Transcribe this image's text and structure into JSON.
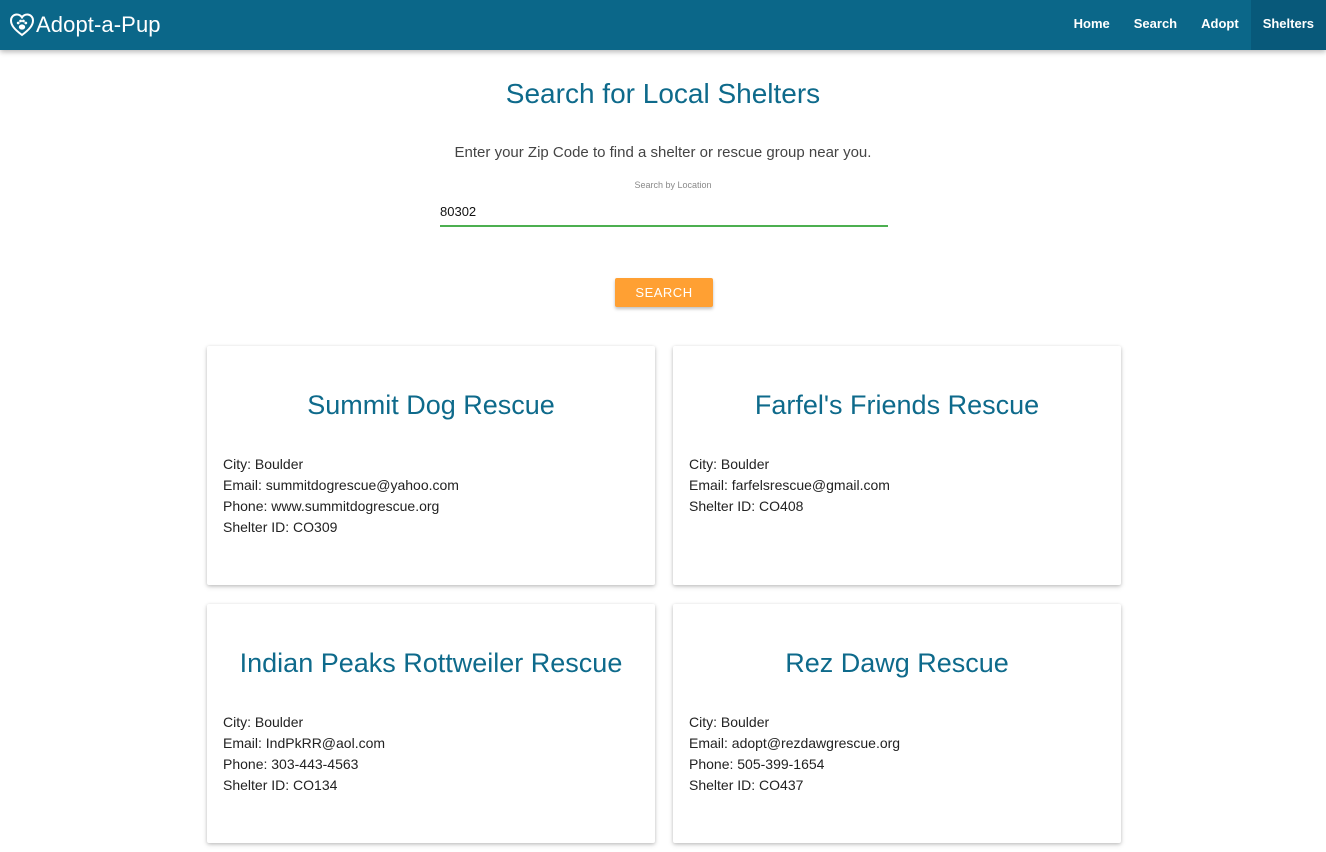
{
  "navbar": {
    "brand": "Adopt-a-Pup",
    "brand_icon": "heart-paw-icon",
    "links": [
      {
        "label": "Home"
      },
      {
        "label": "Search"
      },
      {
        "label": "Adopt"
      },
      {
        "label": "Shelters",
        "active": true
      }
    ],
    "colors": {
      "background": "#0b6789",
      "active": "#08597a"
    }
  },
  "main": {
    "title": "Search for Local Shelters",
    "intro": "Enter your Zip Code to find a shelter or rescue group near you.",
    "search": {
      "label": "Search by Location",
      "value": "80302",
      "button": "SEARCH"
    },
    "colors": {
      "title": "#0e6a8b",
      "button": "#ffa033",
      "input_underline": "#4caf50"
    }
  },
  "shelters": [
    {
      "name": "Summit Dog Rescue",
      "details": [
        "City: Boulder",
        "Email: summitdogrescue@yahoo.com",
        "Phone: www.summitdogrescue.org",
        "Shelter ID: CO309"
      ]
    },
    {
      "name": "Farfel's Friends Rescue",
      "details": [
        "City: Boulder",
        "Email: farfelsrescue@gmail.com",
        "Shelter ID: CO408"
      ]
    },
    {
      "name": "Indian Peaks Rottweiler Rescue",
      "details": [
        "City: Boulder",
        "Email: IndPkRR@aol.com",
        "Phone: 303-443-4563",
        "Shelter ID: CO134"
      ]
    },
    {
      "name": "Rez Dawg Rescue",
      "details": [
        "City: Boulder",
        "Email: adopt@rezdawgrescue.org",
        "Phone: 505-399-1654",
        "Shelter ID: CO437"
      ]
    }
  ]
}
